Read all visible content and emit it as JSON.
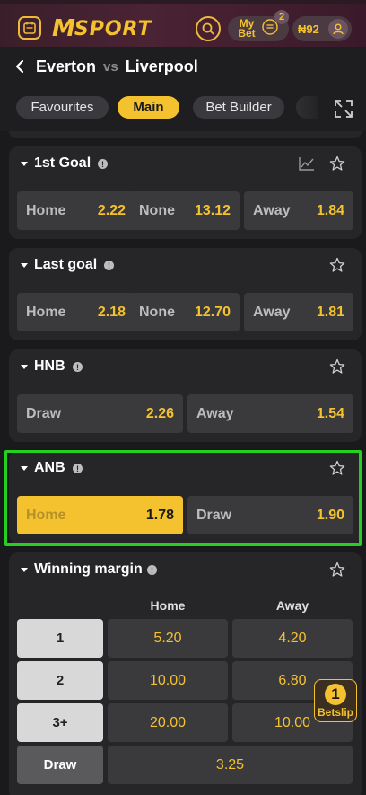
{
  "header": {
    "brand_m": "M",
    "brand_text": "SPORT",
    "mybets_label": "My Bet",
    "mybets_badge": "2",
    "balance": "₦92",
    "colors": {
      "accent": "#f5c22f",
      "header_bg": "#4a2334"
    }
  },
  "match": {
    "home": "Everton",
    "vs": "vs",
    "away": "Liverpool"
  },
  "tabs": [
    {
      "label": "Favourites",
      "active": false
    },
    {
      "label": "Main",
      "active": true
    },
    {
      "label": "Bet Builder",
      "active": false
    }
  ],
  "markets": {
    "first_goal": {
      "title": "1st Goal",
      "odds": [
        {
          "label": "Home",
          "value": "2.22"
        },
        {
          "label": "None",
          "value": "13.12"
        },
        {
          "label": "Away",
          "value": "1.84"
        }
      ]
    },
    "last_goal": {
      "title": "Last goal",
      "odds": [
        {
          "label": "Home",
          "value": "2.18"
        },
        {
          "label": "None",
          "value": "12.70"
        },
        {
          "label": "Away",
          "value": "1.81"
        }
      ]
    },
    "hnb": {
      "title": "HNB",
      "odds": [
        {
          "label": "Draw",
          "value": "2.26"
        },
        {
          "label": "Away",
          "value": "1.54"
        }
      ]
    },
    "anb": {
      "title": "ANB",
      "odds": [
        {
          "label": "Home",
          "value": "1.78",
          "selected": true
        },
        {
          "label": "Draw",
          "value": "1.90"
        }
      ]
    },
    "winning_margin": {
      "title": "Winning margin",
      "col_home": "Home",
      "col_away": "Away",
      "rows": [
        {
          "label": "1",
          "home": "5.20",
          "away": "4.20"
        },
        {
          "label": "2",
          "home": "10.00",
          "away": "6.80"
        },
        {
          "label": "3+",
          "home": "20.00",
          "away": "10.00"
        }
      ],
      "draw_label": "Draw",
      "draw_value": "3.25"
    }
  },
  "betslip": {
    "count": "1",
    "label": "Betslip"
  },
  "icons": [
    "calendar-icon",
    "search-icon",
    "receipt-icon",
    "user-icon",
    "back-icon",
    "expand-icon",
    "chart-icon",
    "star-icon",
    "info-icon"
  ]
}
